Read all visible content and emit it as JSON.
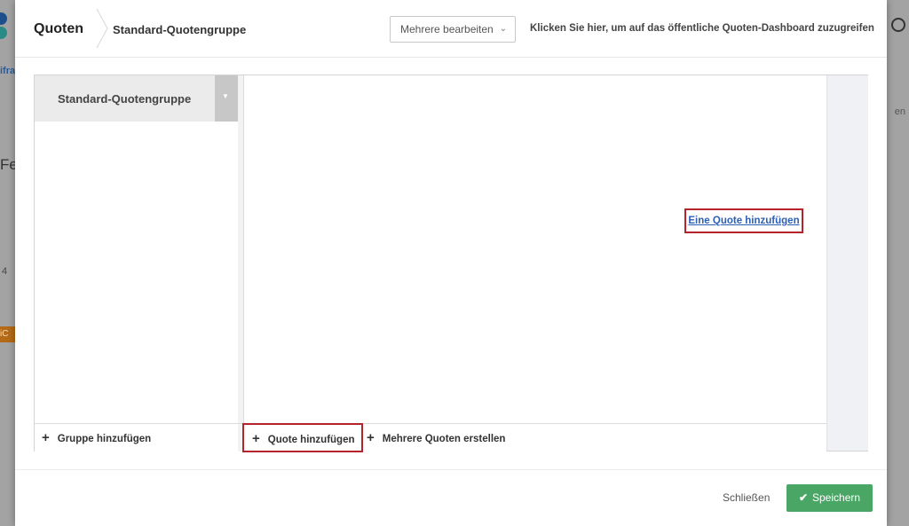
{
  "background": {
    "fragments": [
      "ifra",
      "Fe",
      "4",
      "en",
      "iC"
    ]
  },
  "header": {
    "title": "Quoten",
    "breadcrumb": "Standard-Quotengruppe",
    "multi_edit_label": "Mehrere bearbeiten",
    "dashboard_link": "Klicken Sie hier, um auf das öffentliche Quoten-Dashboard zuzugreifen"
  },
  "groups": {
    "items": [
      {
        "label": "Standard-Quotengruppe"
      }
    ],
    "add_group_label": "Gruppe hinzufügen"
  },
  "main": {
    "add_quote_link": "Eine Quote hinzufügen",
    "add_quote_label": "Quote hinzufügen",
    "add_multiple_label": "Mehrere Quoten erstellen"
  },
  "footer": {
    "close_label": "Schließen",
    "save_label": "Speichern"
  },
  "colors": {
    "highlight": "#b5232b",
    "link": "#2c5fb8",
    "save": "#4aa664"
  },
  "icons": [
    "chevron-down-icon",
    "plus-icon",
    "check-icon",
    "user-icon"
  ]
}
